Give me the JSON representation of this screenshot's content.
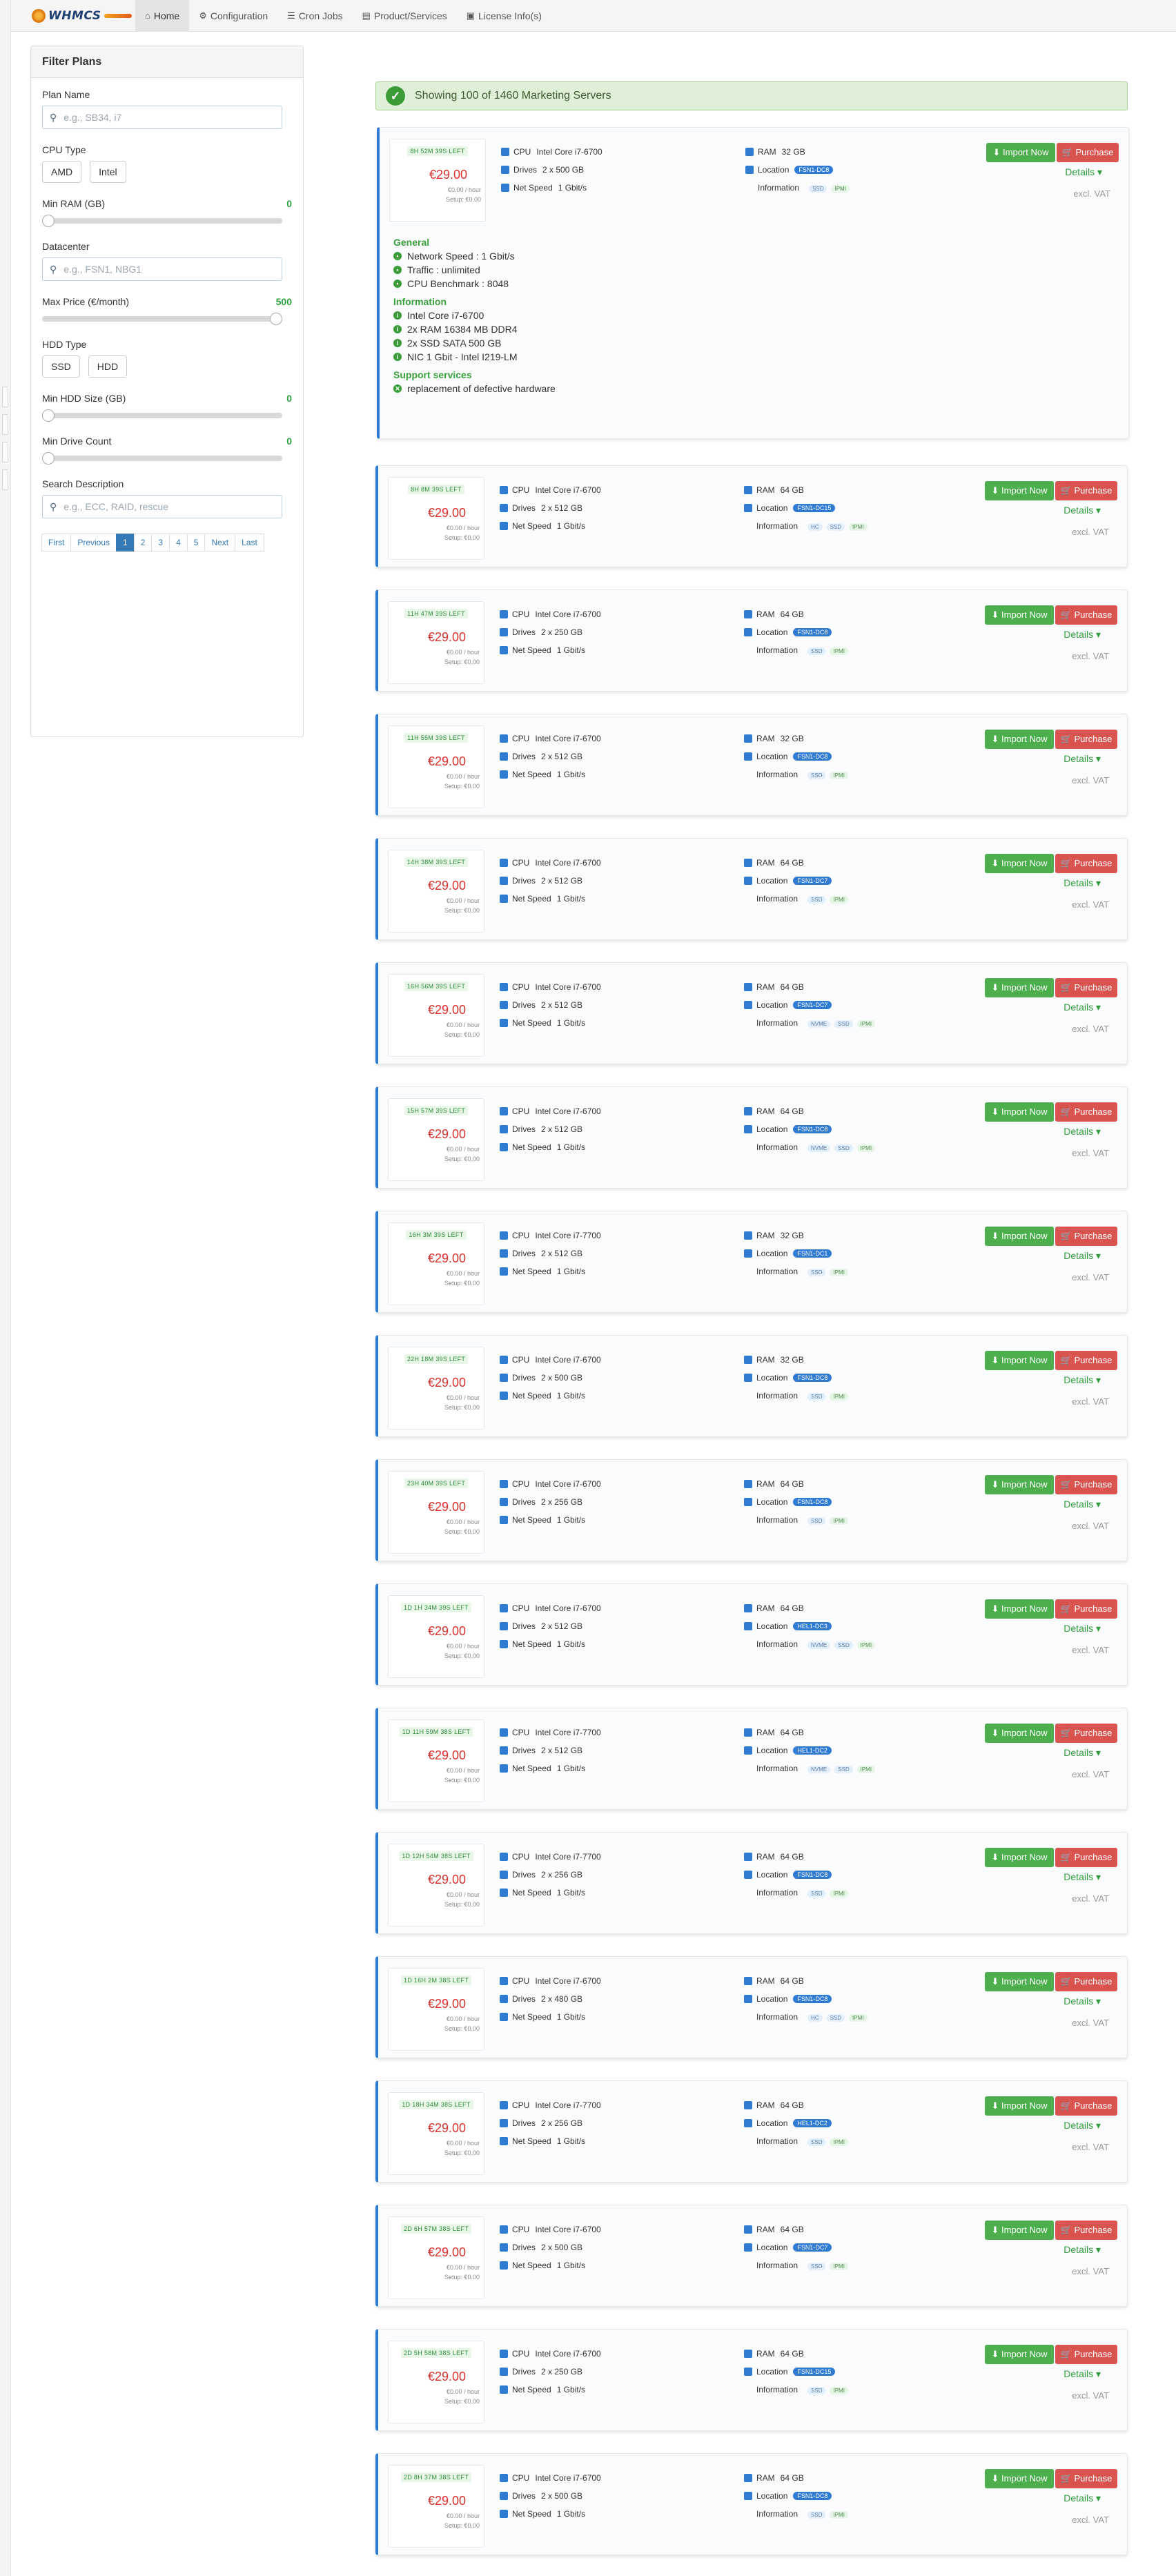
{
  "brand": {
    "logo_text": "WHMCS"
  },
  "nav": {
    "tabs": [
      {
        "label": "Home",
        "icon": "home-icon",
        "active": true
      },
      {
        "label": "Configuration",
        "icon": "cogs-icon"
      },
      {
        "label": "Cron Jobs",
        "icon": "list-icon"
      },
      {
        "label": "Product/Services",
        "icon": "server-icon"
      },
      {
        "label": "License Info(s)",
        "icon": "license-icon"
      }
    ]
  },
  "filter": {
    "title": "Filter Plans",
    "plan_name": {
      "label": "Plan Name",
      "placeholder": "e.g., SB34, i7"
    },
    "cpu_type": {
      "label": "CPU Type",
      "options": [
        "AMD",
        "Intel"
      ]
    },
    "min_ram": {
      "label": "Min RAM (GB)",
      "value": "0",
      "fraction": 0.0
    },
    "datacenter": {
      "label": "Datacenter",
      "placeholder": "e.g., FSN1, NBG1"
    },
    "max_price": {
      "label": "Max Price (€/month)",
      "value": "500",
      "fraction": 1.0
    },
    "hdd_type": {
      "label": "HDD Type",
      "options": [
        "SSD",
        "HDD"
      ]
    },
    "min_hdd": {
      "label": "Min HDD Size (GB)",
      "value": "0",
      "fraction": 0.0
    },
    "min_drive": {
      "label": "Min Drive Count",
      "value": "0",
      "fraction": 0.0
    },
    "search": {
      "label": "Search Description",
      "placeholder": "e.g., ECC, RAID, rescue"
    },
    "pagination": [
      "First",
      "Previous",
      "1",
      "2",
      "3",
      "4",
      "5",
      "Next",
      "Last"
    ],
    "active_page": "1"
  },
  "alert": {
    "text": "Showing 100 of 1460 Marketing Servers"
  },
  "labels": {
    "cpu": "CPU",
    "drives": "Drives",
    "net": "Net Speed",
    "ram": "RAM",
    "location": "Location",
    "information": "Information",
    "import": "Import Now",
    "purchase": "Purchase",
    "details": "Details ▾",
    "vat": "excl. VAT",
    "hourly": "€0.00 / hour",
    "setup": "Setup: €0.00"
  },
  "expanded": {
    "general_title": "General",
    "general": [
      "Network Speed : 1 Gbit/s",
      "Traffic : unlimited",
      "CPU Benchmark : 8048"
    ],
    "info_title": "Information",
    "info": [
      "Intel Core i7-6700",
      "2x RAM 16384 MB DDR4",
      "2x SSD SATA 500 GB",
      "NIC 1 Gbit - Intel I219-LM"
    ],
    "support_title": "Support services",
    "support": [
      "replacement of defective hardware"
    ]
  },
  "servers": [
    {
      "timer": "8H 52M 39S LEFT",
      "price": "€29.00",
      "cpu": "Intel Core i7-6700",
      "drives": "2 x 500 GB",
      "net": "1 Gbit/s",
      "ram": "32 GB",
      "loc": "FSN1-DC8",
      "tags": [
        "SSD",
        "IPMI"
      ]
    },
    {
      "timer": "8H 8M 39S LEFT",
      "price": "€29.00",
      "cpu": "Intel Core i7-6700",
      "drives": "2 x 512 GB",
      "net": "1 Gbit/s",
      "ram": "64 GB",
      "loc": "FSN1-DC15",
      "tags": [
        "HC",
        "SSD",
        "IPMI"
      ]
    },
    {
      "timer": "11H 47M 39S LEFT",
      "price": "€29.00",
      "cpu": "Intel Core i7-6700",
      "drives": "2 x 250 GB",
      "net": "1 Gbit/s",
      "ram": "64 GB",
      "loc": "FSN1-DC8",
      "tags": [
        "SSD",
        "IPMI"
      ]
    },
    {
      "timer": "11H 55M 39S LEFT",
      "price": "€29.00",
      "cpu": "Intel Core i7-6700",
      "drives": "2 x 512 GB",
      "net": "1 Gbit/s",
      "ram": "32 GB",
      "loc": "FSN1-DC8",
      "tags": [
        "SSD",
        "IPMI"
      ]
    },
    {
      "timer": "14H 38M 39S LEFT",
      "price": "€29.00",
      "cpu": "Intel Core i7-6700",
      "drives": "2 x 512 GB",
      "net": "1 Gbit/s",
      "ram": "64 GB",
      "loc": "FSN1-DC7",
      "tags": [
        "SSD",
        "IPMI"
      ]
    },
    {
      "timer": "16H 56M 39S LEFT",
      "price": "€29.00",
      "cpu": "Intel Core i7-6700",
      "drives": "2 x 512 GB",
      "net": "1 Gbit/s",
      "ram": "64 GB",
      "loc": "FSN1-DC7",
      "tags": [
        "NVME",
        "SSD",
        "IPMI"
      ]
    },
    {
      "timer": "15H 57M 39S LEFT",
      "price": "€29.00",
      "cpu": "Intel Core i7-6700",
      "drives": "2 x 512 GB",
      "net": "1 Gbit/s",
      "ram": "64 GB",
      "loc": "FSN1-DC8",
      "tags": [
        "NVME",
        "SSD",
        "IPMI"
      ]
    },
    {
      "timer": "16H 3M 39S LEFT",
      "price": "€29.00",
      "cpu": "Intel Core i7-7700",
      "drives": "2 x 512 GB",
      "net": "1 Gbit/s",
      "ram": "32 GB",
      "loc": "FSN1-DC1",
      "tags": [
        "SSD",
        "IPMI"
      ]
    },
    {
      "timer": "22H 18M 39S LEFT",
      "price": "€29.00",
      "cpu": "Intel Core i7-6700",
      "drives": "2 x 500 GB",
      "net": "1 Gbit/s",
      "ram": "32 GB",
      "loc": "FSN1-DC8",
      "tags": [
        "SSD",
        "IPMI"
      ]
    },
    {
      "timer": "23H 40M 39S LEFT",
      "price": "€29.00",
      "cpu": "Intel Core i7-6700",
      "drives": "2 x 256 GB",
      "net": "1 Gbit/s",
      "ram": "64 GB",
      "loc": "FSN1-DC8",
      "tags": [
        "SSD",
        "IPMI"
      ]
    },
    {
      "timer": "1D 1H 34M 39S LEFT",
      "price": "€29.00",
      "cpu": "Intel Core i7-6700",
      "drives": "2 x 512 GB",
      "net": "1 Gbit/s",
      "ram": "64 GB",
      "loc": "HEL1-DC3",
      "tags": [
        "NVME",
        "SSD",
        "IPMI"
      ]
    },
    {
      "timer": "1D 11H 59M 38S LEFT",
      "price": "€29.00",
      "cpu": "Intel Core i7-7700",
      "drives": "2 x 512 GB",
      "net": "1 Gbit/s",
      "ram": "64 GB",
      "loc": "HEL1-DC2",
      "tags": [
        "NVME",
        "SSD",
        "IPMI"
      ]
    },
    {
      "timer": "1D 12H 54M 38S LEFT",
      "price": "€29.00",
      "cpu": "Intel Core i7-7700",
      "drives": "2 x 256 GB",
      "net": "1 Gbit/s",
      "ram": "64 GB",
      "loc": "FSN1-DC8",
      "tags": [
        "SSD",
        "IPMI"
      ]
    },
    {
      "timer": "1D 16H 2M 38S LEFT",
      "price": "€29.00",
      "cpu": "Intel Core i7-6700",
      "drives": "2 x 480 GB",
      "net": "1 Gbit/s",
      "ram": "64 GB",
      "loc": "FSN1-DC8",
      "tags": [
        "HC",
        "SSD",
        "IPMI"
      ]
    },
    {
      "timer": "1D 18H 34M 38S LEFT",
      "price": "€29.00",
      "cpu": "Intel Core i7-7700",
      "drives": "2 x 256 GB",
      "net": "1 Gbit/s",
      "ram": "64 GB",
      "loc": "HEL1-DC2",
      "tags": [
        "SSD",
        "IPMI"
      ]
    },
    {
      "timer": "2D 6H 57M 38S LEFT",
      "price": "€29.00",
      "cpu": "Intel Core i7-6700",
      "drives": "2 x 500 GB",
      "net": "1 Gbit/s",
      "ram": "64 GB",
      "loc": "FSN1-DC7",
      "tags": [
        "SSD",
        "IPMI"
      ]
    },
    {
      "timer": "2D 5H 58M 38S LEFT",
      "price": "€29.00",
      "cpu": "Intel Core i7-6700",
      "drives": "2 x 250 GB",
      "net": "1 Gbit/s",
      "ram": "64 GB",
      "loc": "FSN1-DC15",
      "tags": [
        "SSD",
        "IPMI"
      ]
    },
    {
      "timer": "2D 8H 37M 38S LEFT",
      "price": "€29.00",
      "cpu": "Intel Core i7-6700",
      "drives": "2 x 500 GB",
      "net": "1 Gbit/s",
      "ram": "64 GB",
      "loc": "FSN1-DC8",
      "tags": [
        "SSD",
        "IPMI"
      ]
    }
  ]
}
